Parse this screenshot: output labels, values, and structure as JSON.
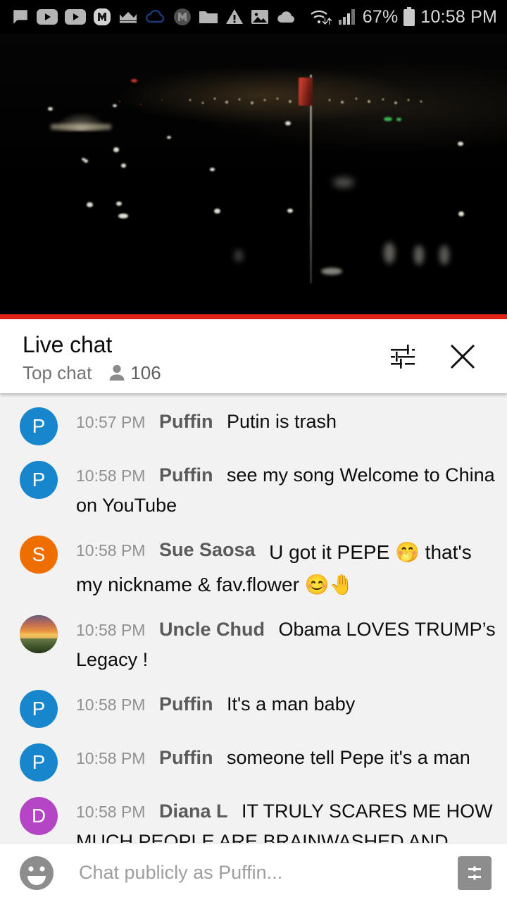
{
  "status_bar": {
    "icons": [
      "chat-bubble-icon",
      "youtube-icon",
      "youtube-icon",
      "m-badge-icon",
      "crown-icon",
      "cloud-outline-icon",
      "m-circle-icon",
      "folder-icon",
      "warning-triangle-icon",
      "image-icon",
      "cloud-filled-icon"
    ],
    "wifi_icon": "wifi-transfer-icon",
    "signal_icon": "cellular-signal-icon",
    "battery_percent": "67%",
    "battery_icon": "battery-icon",
    "clock": "10:58 PM"
  },
  "video": {
    "name": "live-video-player",
    "progress_color": "#e3221a",
    "progress_percent": 100
  },
  "chat_header": {
    "title": "Live chat",
    "mode": "Top chat",
    "viewer_icon": "person-icon",
    "viewer_count": "106",
    "settings_icon": "tune-icon",
    "close_icon": "close-icon"
  },
  "messages": [
    {
      "time": "10:57 PM",
      "author": "Puffin",
      "text": "Putin is trash",
      "avatar_letter": "P",
      "avatar_color": "#1886cd",
      "avatar_type": "letter"
    },
    {
      "time": "10:58 PM",
      "author": "Puffin",
      "text": "see my song Welcome to China on YouTube",
      "avatar_letter": "P",
      "avatar_color": "#1886cd",
      "avatar_type": "letter"
    },
    {
      "time": "10:58 PM",
      "author": "Sue Saosa",
      "text": "U got it PEPE 🤭 that's my nickname & fav.flower 😊🤚",
      "avatar_letter": "S",
      "avatar_color": "#ee6f00",
      "avatar_type": "letter"
    },
    {
      "time": "10:58 PM",
      "author": "Uncle Chud",
      "text": "Obama LOVES TRUMP’s Legacy !",
      "avatar_letter": "",
      "avatar_color": "#c06c52",
      "avatar_type": "photo"
    },
    {
      "time": "10:58 PM",
      "author": "Puffin",
      "text": "It's a man baby",
      "avatar_letter": "P",
      "avatar_color": "#1886cd",
      "avatar_type": "letter"
    },
    {
      "time": "10:58 PM",
      "author": "Puffin",
      "text": "someone tell Pepe it's a man",
      "avatar_letter": "P",
      "avatar_color": "#1886cd",
      "avatar_type": "letter"
    },
    {
      "time": "10:58 PM",
      "author": "Diana L",
      "text": "IT TRULY SCARES ME HOW MUCH PEOPLE ARE BRAINWASHED AND DON'T EVEN REALIZE IT",
      "avatar_letter": "D",
      "avatar_color": "#b445c5",
      "avatar_type": "letter"
    }
  ],
  "input_bar": {
    "emoji_icon": "emoji-smiley-icon",
    "placeholder": "Chat publicly as Puffin...",
    "value": "",
    "superchat_icon": "superchat-dollar-icon"
  }
}
